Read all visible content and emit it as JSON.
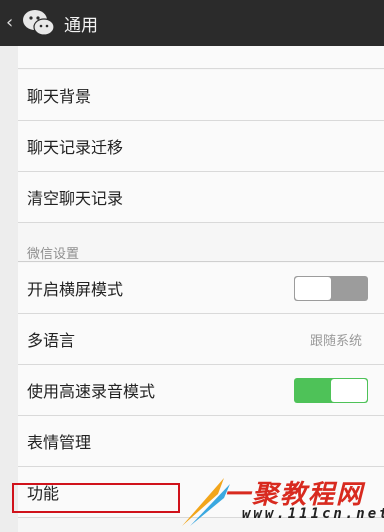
{
  "header": {
    "back_glyph": "‹",
    "title": "通用"
  },
  "rows": [
    {
      "label": "聊天背景"
    },
    {
      "label": "聊天记录迁移"
    },
    {
      "label": "清空聊天记录"
    }
  ],
  "section": {
    "label": "微信设置"
  },
  "settings": {
    "landscape": {
      "label": "开启横屏模式",
      "enabled": false
    },
    "language": {
      "label": "多语言",
      "value": "跟随系统"
    },
    "fast_audio": {
      "label": "使用高速录音模式",
      "enabled": true
    },
    "stickers": {
      "label": "表情管理"
    },
    "features": {
      "label": "功能"
    }
  },
  "watermark": {
    "title": "一聚教程网",
    "url": "www.111cn.net"
  },
  "colors": {
    "toggle_on": "#4ec258",
    "toggle_off": "#9c9c9c",
    "highlight": "#d0121b",
    "header": "#2b2b2b"
  }
}
